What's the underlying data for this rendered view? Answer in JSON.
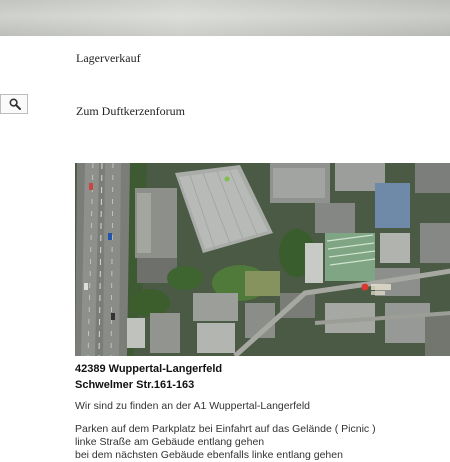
{
  "header": {
    "banner": ""
  },
  "nav": {
    "lagerverkauf": "Lagerverkauf",
    "forum": "Zum Duftkerzenforum"
  },
  "search": {
    "icon": "search-icon"
  },
  "address": {
    "line1": "42389 Wuppertal-Langerfeld",
    "line2": "Schwelmer Str.161-163",
    "find": "Wir sind zu finden an der A1 Wuppertal-Langerfeld",
    "directions": [
      "Parken auf dem Parkplatz bei Einfahrt auf das Gelände ( Picnic )",
      "linke Straße am Gebäude entlang gehen",
      "bei dem nächsten Gebäude ebenfalls linke entlang gehen"
    ]
  }
}
